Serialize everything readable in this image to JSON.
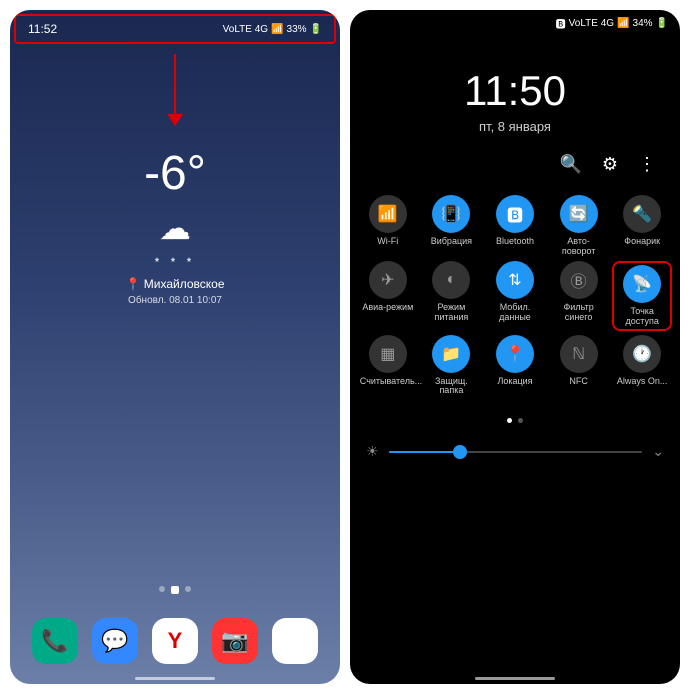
{
  "left": {
    "status": {
      "time": "11:52",
      "net": "VoLTE 4G",
      "battery": "33%"
    },
    "weather": {
      "temp": "-6°",
      "location": "Михайловское",
      "updated": "Обновл. 08.01 10:07"
    },
    "dock": [
      "phone",
      "messages",
      "yandex",
      "camera",
      "play"
    ]
  },
  "right": {
    "status": {
      "net": "VoLTE 4G",
      "battery": "34%"
    },
    "clock": {
      "time": "11:50",
      "date": "пт, 8 января"
    },
    "tiles": [
      {
        "label": "Wi-Fi",
        "on": false,
        "icon": "wifi"
      },
      {
        "label": "Вибрация",
        "on": true,
        "icon": "vibrate"
      },
      {
        "label": "Bluetooth",
        "on": true,
        "icon": "bt"
      },
      {
        "label": "Авто-поворот",
        "on": true,
        "icon": "rotate"
      },
      {
        "label": "Фонарик",
        "on": false,
        "icon": "flash"
      },
      {
        "label": "Авиа-режим",
        "on": false,
        "icon": "plane"
      },
      {
        "label": "Режим питания",
        "on": false,
        "icon": "power"
      },
      {
        "label": "Мобил. данные",
        "on": true,
        "icon": "data"
      },
      {
        "label": "Фильтр синего",
        "on": false,
        "icon": "blue"
      },
      {
        "label": "Точка доступа",
        "on": true,
        "icon": "hotspot",
        "highlight": true
      },
      {
        "label": "Считыватель...",
        "on": false,
        "icon": "qr"
      },
      {
        "label": "Защищ. папка",
        "on": true,
        "icon": "folder"
      },
      {
        "label": "Локация",
        "on": true,
        "icon": "loc"
      },
      {
        "label": "NFC",
        "on": false,
        "icon": "nfc"
      },
      {
        "label": "Always On...",
        "on": false,
        "icon": "aod"
      }
    ],
    "brightness": 28
  },
  "icons": {
    "wifi": "📶",
    "vibrate": "📳",
    "bt": "🅱",
    "rotate": "🔄",
    "flash": "🔦",
    "plane": "✈",
    "power": "◐",
    "data": "⇅",
    "blue": "Ⓑ",
    "hotspot": "📡",
    "qr": "▦",
    "folder": "📁",
    "loc": "📍",
    "nfc": "ℕ",
    "aod": "🕐"
  }
}
